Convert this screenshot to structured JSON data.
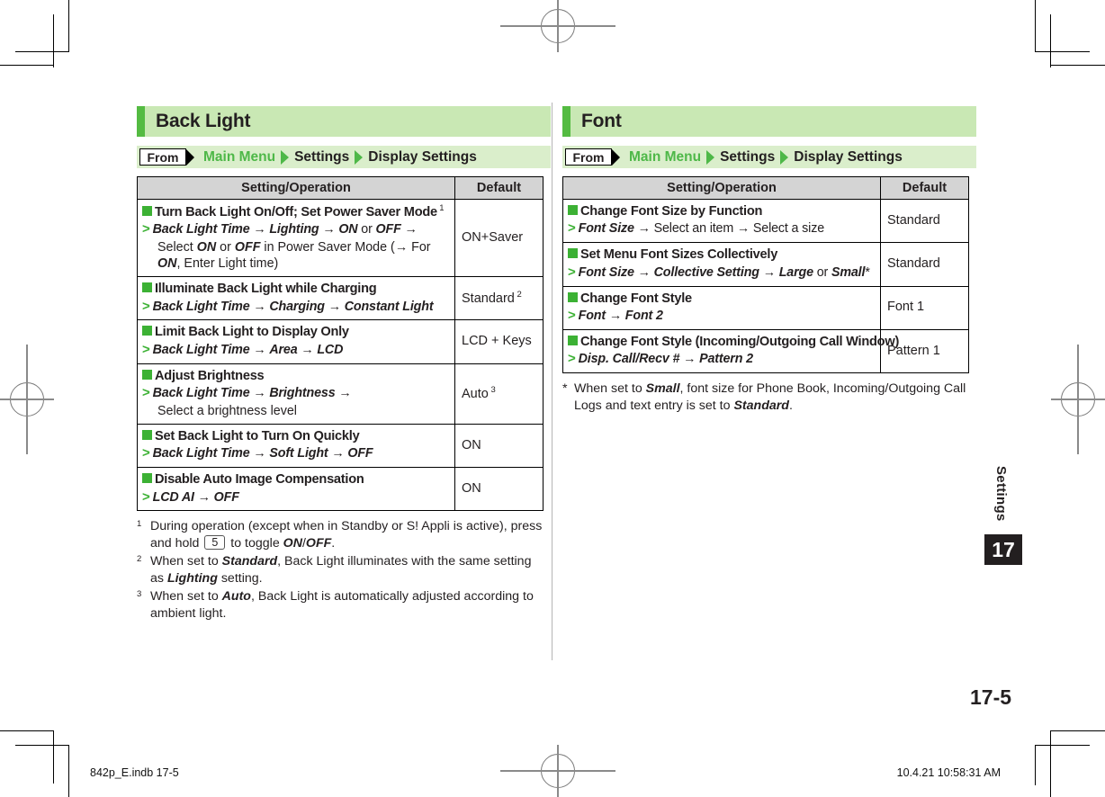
{
  "document": {
    "page_number": "17-5",
    "chapter_label": "Settings",
    "chapter_number": "17",
    "footer_left": "842p_E.indb   17-5",
    "footer_right": "10.4.21   10:58:31 AM"
  },
  "colors": {
    "accent_green": "#54bb42",
    "header_band": "#c9e8b4",
    "crumb_band": "#daeecb",
    "bullet_green": "#3cb134",
    "crumb_green": "#4eb848",
    "table_head_gray": "#d4d4d4",
    "ink": "#231f20"
  },
  "sections": [
    {
      "title": "Back Light",
      "breadcrumb": {
        "from_label": "From",
        "items": [
          {
            "text": "Main Menu",
            "style": "green"
          },
          {
            "text": "Settings",
            "style": "black"
          },
          {
            "text": "Display Settings",
            "style": "black"
          }
        ]
      },
      "table": {
        "headers": {
          "operation": "Setting/Operation",
          "default": "Default"
        },
        "rows": [
          {
            "title": "Turn Back Light On/Off; Set Power Saver Mode",
            "title_note": "1",
            "step_segments": [
              {
                "text": "Back Light Time",
                "style": "bold-italic"
              },
              {
                "text": " → ",
                "style": "plain"
              },
              {
                "text": "Lighting",
                "style": "bold-italic"
              },
              {
                "text": " → ",
                "style": "plain"
              },
              {
                "text": "ON",
                "style": "bold-italic"
              },
              {
                "text": " or ",
                "style": "plain"
              },
              {
                "text": "OFF",
                "style": "bold-italic"
              },
              {
                "text": " →",
                "style": "plain"
              }
            ],
            "continuation_segments": [
              {
                "text": "Select ",
                "style": "plain"
              },
              {
                "text": "ON",
                "style": "bold-italic"
              },
              {
                "text": " or ",
                "style": "plain"
              },
              {
                "text": "OFF",
                "style": "bold-italic"
              },
              {
                "text": " in Power Saver Mode (→ For ",
                "style": "plain"
              },
              {
                "text": "ON",
                "style": "bold-italic"
              },
              {
                "text": ",",
                "style": "plain"
              },
              {
                "text": "\nEnter Light time)",
                "style": "plain"
              }
            ],
            "default": "ON+Saver",
            "default_note": ""
          },
          {
            "title": "Illuminate Back Light while Charging",
            "title_note": "",
            "step_segments": [
              {
                "text": "Back Light Time",
                "style": "bold-italic"
              },
              {
                "text": " → ",
                "style": "plain"
              },
              {
                "text": "Charging",
                "style": "bold-italic"
              },
              {
                "text": " → ",
                "style": "plain"
              },
              {
                "text": "Constant Light",
                "style": "bold-italic"
              }
            ],
            "continuation_segments": [],
            "default": "Standard",
            "default_note": "2"
          },
          {
            "title": "Limit Back Light to Display Only",
            "title_note": "",
            "step_segments": [
              {
                "text": "Back Light Time",
                "style": "bold-italic"
              },
              {
                "text": " → ",
                "style": "plain"
              },
              {
                "text": "Area",
                "style": "bold-italic"
              },
              {
                "text": " → ",
                "style": "plain"
              },
              {
                "text": "LCD",
                "style": "bold-italic"
              }
            ],
            "continuation_segments": [],
            "default": "LCD + Keys",
            "default_note": ""
          },
          {
            "title": "Adjust Brightness",
            "title_note": "",
            "step_segments": [
              {
                "text": "Back Light Time",
                "style": "bold-italic"
              },
              {
                "text": " → ",
                "style": "plain"
              },
              {
                "text": "Brightness",
                "style": "bold-italic"
              },
              {
                "text": " →",
                "style": "plain"
              }
            ],
            "continuation_segments": [
              {
                "text": "Select a brightness level",
                "style": "plain"
              }
            ],
            "default": "Auto",
            "default_note": "3"
          },
          {
            "title": "Set Back Light to Turn On Quickly",
            "title_note": "",
            "step_segments": [
              {
                "text": "Back Light Time",
                "style": "bold-italic"
              },
              {
                "text": " → ",
                "style": "plain"
              },
              {
                "text": "Soft Light",
                "style": "bold-italic"
              },
              {
                "text": " → ",
                "style": "plain"
              },
              {
                "text": "OFF",
                "style": "bold-italic"
              }
            ],
            "continuation_segments": [],
            "default": "ON",
            "default_note": ""
          },
          {
            "title": "Disable Auto Image Compensation",
            "title_note": "",
            "step_segments": [
              {
                "text": "LCD AI",
                "style": "bold-italic"
              },
              {
                "text": " → ",
                "style": "plain"
              },
              {
                "text": "OFF",
                "style": "bold-italic"
              }
            ],
            "continuation_segments": [],
            "default": "ON",
            "default_note": ""
          }
        ]
      },
      "footnotes": [
        {
          "mark": "1",
          "segments": [
            {
              "text": "During operation (except when in Standby or S! Appli is active), press and hold ",
              "style": "plain"
            },
            {
              "text": "5",
              "style": "key"
            },
            {
              "text": " to toggle ",
              "style": "plain"
            },
            {
              "text": "ON",
              "style": "bold-italic"
            },
            {
              "text": "/",
              "style": "plain"
            },
            {
              "text": "OFF",
              "style": "bold-italic"
            },
            {
              "text": ".",
              "style": "plain"
            }
          ]
        },
        {
          "mark": "2",
          "segments": [
            {
              "text": "When set to ",
              "style": "plain"
            },
            {
              "text": "Standard",
              "style": "bold-italic"
            },
            {
              "text": ", Back Light illuminates with the same setting as ",
              "style": "plain"
            },
            {
              "text": "Lighting",
              "style": "bold-italic"
            },
            {
              "text": " setting.",
              "style": "plain"
            }
          ]
        },
        {
          "mark": "3",
          "segments": [
            {
              "text": "When set to ",
              "style": "plain"
            },
            {
              "text": "Auto",
              "style": "bold-italic"
            },
            {
              "text": ", Back Light is automatically adjusted according to ambient light.",
              "style": "plain"
            }
          ]
        }
      ]
    },
    {
      "title": "Font",
      "breadcrumb": {
        "from_label": "From",
        "items": [
          {
            "text": "Main Menu",
            "style": "green"
          },
          {
            "text": "Settings",
            "style": "black"
          },
          {
            "text": "Display Settings",
            "style": "black"
          }
        ]
      },
      "table": {
        "headers": {
          "operation": "Setting/Operation",
          "default": "Default"
        },
        "rows": [
          {
            "title": "Change Font Size by Function",
            "title_note": "",
            "step_segments": [
              {
                "text": "Font Size",
                "style": "bold-italic"
              },
              {
                "text": " → Select an item → Select a size",
                "style": "plain"
              }
            ],
            "continuation_segments": [],
            "default": "Standard",
            "default_note": ""
          },
          {
            "title": "Set Menu Font Sizes Collectively",
            "title_note": "",
            "step_segments": [
              {
                "text": "Font Size",
                "style": "bold-italic"
              },
              {
                "text": " → ",
                "style": "plain"
              },
              {
                "text": "Collective Setting",
                "style": "bold-italic"
              },
              {
                "text": " → ",
                "style": "plain"
              },
              {
                "text": "Large",
                "style": "bold-italic"
              },
              {
                "text": " or ",
                "style": "plain"
              },
              {
                "text": "Small",
                "style": "bold-italic"
              },
              {
                "text": "*",
                "style": "plain"
              }
            ],
            "continuation_segments": [],
            "default": "Standard",
            "default_note": ""
          },
          {
            "title": "Change Font Style",
            "title_note": "",
            "step_segments": [
              {
                "text": "Font",
                "style": "bold-italic"
              },
              {
                "text": " → ",
                "style": "plain"
              },
              {
                "text": "Font 2",
                "style": "bold-italic"
              }
            ],
            "continuation_segments": [],
            "default": "Font 1",
            "default_note": ""
          },
          {
            "title": "Change Font Style (Incoming/Outgoing Call Window)",
            "title_note": "",
            "step_segments": [
              {
                "text": "Disp. Call/Recv #",
                "style": "bold-italic"
              },
              {
                "text": " → ",
                "style": "plain"
              },
              {
                "text": "Pattern 2",
                "style": "bold-italic"
              }
            ],
            "continuation_segments": [],
            "default": "Pattern 1",
            "default_note": ""
          }
        ]
      },
      "footnotes": [
        {
          "mark": "*",
          "segments": [
            {
              "text": "When set to ",
              "style": "plain"
            },
            {
              "text": "Small",
              "style": "bold-italic"
            },
            {
              "text": ", font size for Phone Book, Incoming/Outgoing Call Logs and text entry is set to ",
              "style": "plain"
            },
            {
              "text": "Standard",
              "style": "bold-italic"
            },
            {
              "text": ".",
              "style": "plain"
            }
          ]
        }
      ]
    }
  ]
}
